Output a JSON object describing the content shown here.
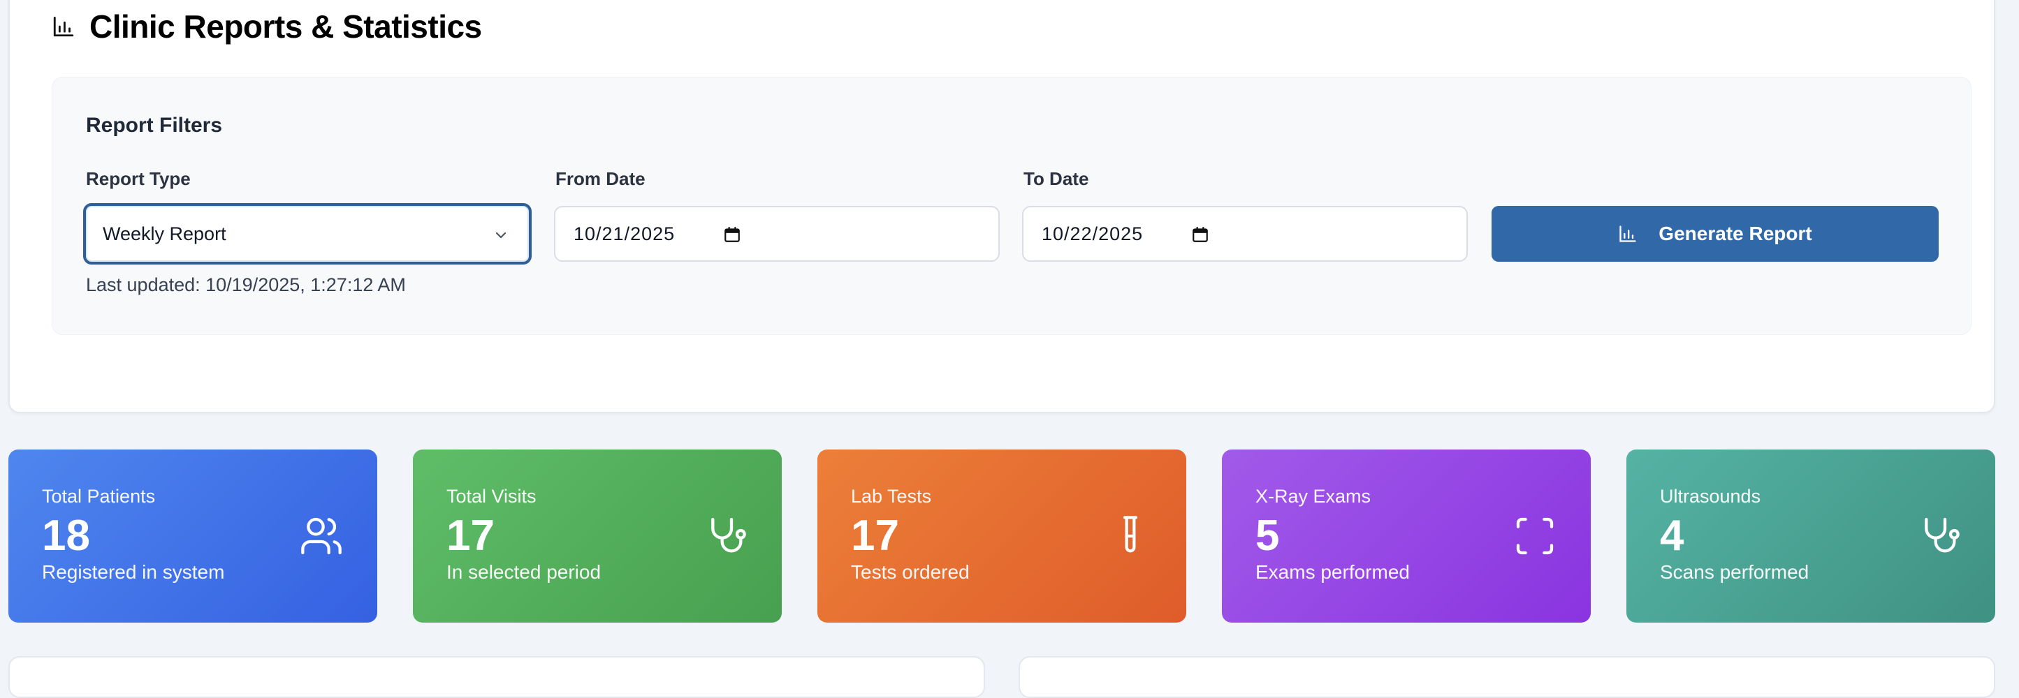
{
  "header": {
    "title": "Clinic Reports & Statistics",
    "icon": "bar-chart-icon"
  },
  "filters": {
    "heading": "Report Filters",
    "report_type_label": "Report Type",
    "report_type_value": "Weekly Report",
    "from_date_label": "From Date",
    "from_date_value": "10/21/2025",
    "to_date_label": "To Date",
    "to_date_value": "10/22/2025",
    "generate_label": "Generate Report",
    "last_updated": "Last updated: 10/19/2025, 1:27:12 AM"
  },
  "stats": [
    {
      "label": "Total Patients",
      "value": "18",
      "sub": "Registered in system",
      "icon": "users-icon",
      "color": "#3a6be4"
    },
    {
      "label": "Total Visits",
      "value": "17",
      "sub": "In selected period",
      "icon": "stethoscope-icon",
      "color": "#4caa55"
    },
    {
      "label": "Lab Tests",
      "value": "17",
      "sub": "Tests ordered",
      "icon": "test-tube-icon",
      "color": "#e4692f"
    },
    {
      "label": "X-Ray Exams",
      "value": "5",
      "sub": "Exams performed",
      "icon": "scan-icon",
      "color": "#9043e3"
    },
    {
      "label": "Ultrasounds",
      "value": "4",
      "sub": "Scans performed",
      "icon": "stethoscope-icon",
      "color": "#47a191"
    }
  ],
  "colors": {
    "primary_button": "#3169a8",
    "focus_border": "#2f5f95",
    "page_background": "#f1f4f8"
  }
}
